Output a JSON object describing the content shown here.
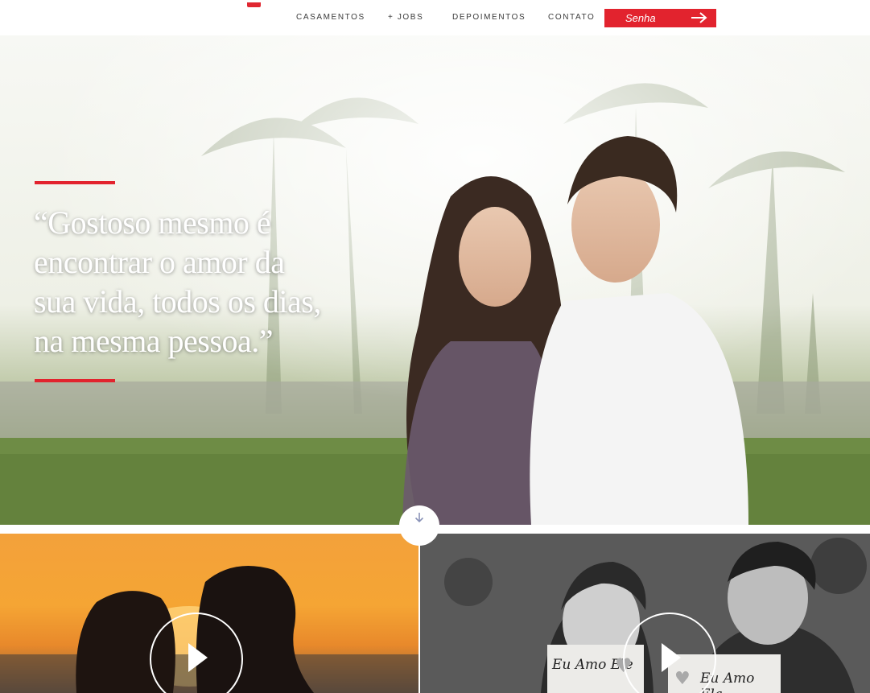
{
  "header": {
    "nav": [
      "CASAMENTOS",
      "+ JOBS",
      "DEPOIMENTOS",
      "CONTATO"
    ],
    "login_button": "Senha",
    "accent_color": "#e2232e"
  },
  "hero": {
    "quote_lines": [
      "“Gostoso mesmo é",
      "encontrar o amor da",
      "sua vida, todos os dias,",
      "na mesma pessoa.”"
    ],
    "scroll_icon": "arrow-down-icon"
  },
  "tiles": [
    {
      "play_icon": "play-icon",
      "tone": "sunset"
    },
    {
      "play_icon": "play-icon",
      "tone": "black-and-white",
      "signs": [
        "Eu Amo Ele",
        "Eu Amo Ela"
      ]
    }
  ]
}
